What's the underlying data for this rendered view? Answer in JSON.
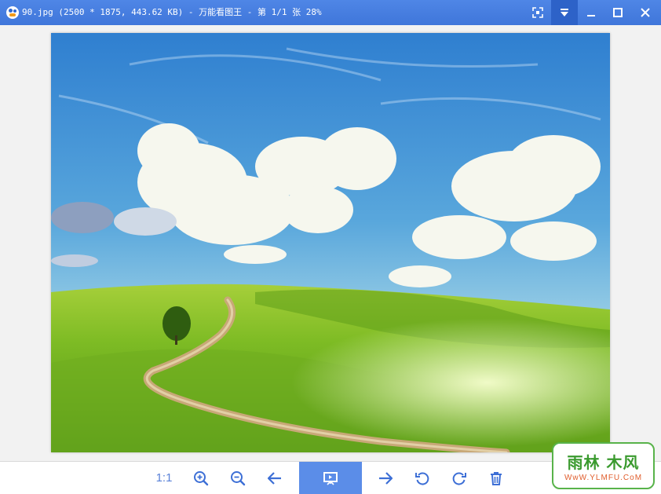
{
  "window": {
    "title": "90.jpg (2500 * 1875, 443.62 KB) - 万能看图王 - 第 1/1 张 28%",
    "buttons": [
      "fullscreen-icon",
      "dropdown-icon",
      "minimize-icon",
      "maximize-icon",
      "close-icon"
    ]
  },
  "image": {
    "description_icon": "landscape-photo",
    "colors": {
      "sky_top": "#2f7fd0",
      "sky_bottom": "#bfe3ef",
      "grass": "#6cb21e",
      "path": "#c8a878"
    }
  },
  "toolbar": {
    "actual_size_label": "1:1",
    "tools": [
      "actual-size",
      "zoom-in-icon",
      "zoom-out-icon",
      "prev-arrow-icon",
      "slideshow-icon",
      "next-arrow-icon",
      "rotate-left-icon",
      "rotate-right-icon",
      "delete-icon"
    ],
    "accent": "#3d6fd6",
    "primary_bg": "#5b8de8"
  },
  "watermark": {
    "main": "雨林 木风",
    "sub": "WwW.YLMFU.CoM"
  }
}
